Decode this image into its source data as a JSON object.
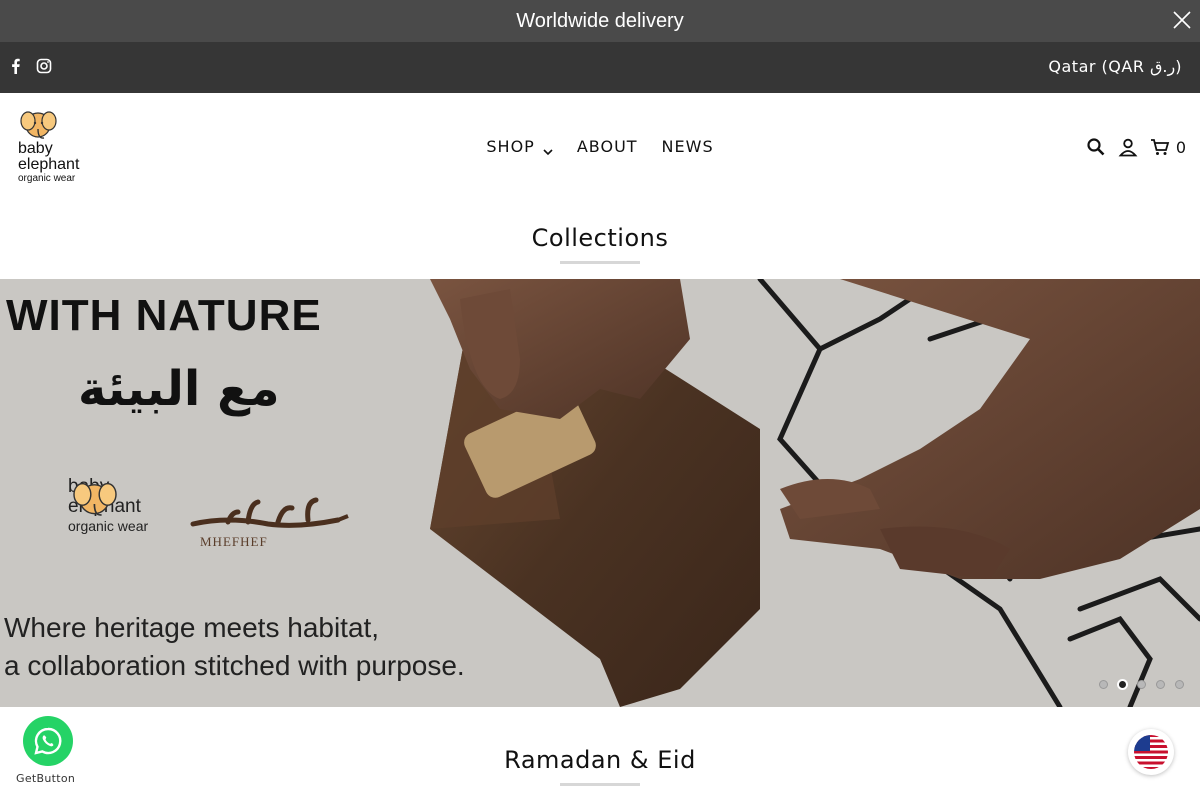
{
  "announcement": {
    "text": "Worldwide delivery"
  },
  "topbar": {
    "currency": "Qatar (QAR ر.ق)"
  },
  "logo": {
    "line1": "baby",
    "line2": "elephant",
    "line3": "organic wear"
  },
  "nav": {
    "items": [
      {
        "label": "SHOP"
      },
      {
        "label": "ABOUT"
      },
      {
        "label": "NEWS"
      }
    ]
  },
  "cart": {
    "count": "0"
  },
  "collections": {
    "title": "Collections"
  },
  "hero": {
    "heading": "WITH NATURE",
    "heading_ar": "مع البيئة",
    "partner": "MHEFHEF",
    "tagline_line1": "Where heritage meets habitat,",
    "tagline_line2": "a collaboration stitched with purpose.",
    "slides_total": 5,
    "active_slide": 2
  },
  "section2": {
    "title": "Ramadan & Eid"
  },
  "widget": {
    "getbutton": "GetButton"
  },
  "colors": {
    "announce_bg": "#4a4a4a",
    "topbar_bg": "#363636",
    "whatsapp": "#25d366"
  }
}
